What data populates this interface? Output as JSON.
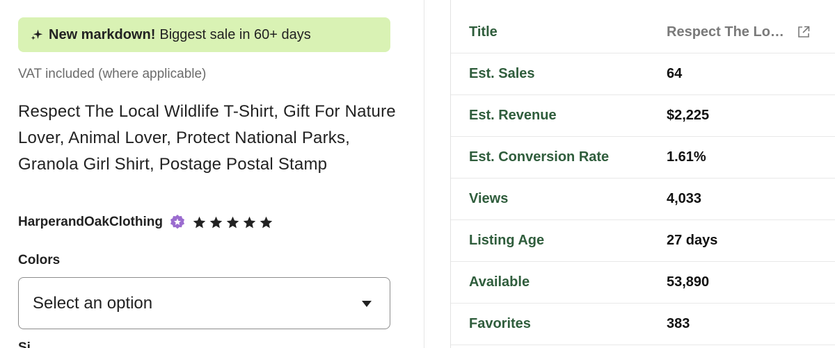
{
  "listing": {
    "banner_bold": "New markdown!",
    "banner_text": "Biggest sale in 60+ days",
    "vat_text": "VAT included (where applicable)",
    "title": "Respect The Local Wildlife T-Shirt, Gift For Nature Lover, Animal Lover, Protect National Parks, Granola Girl Shirt, Postage Postal Stamp",
    "shop_name": "HarperandOakClothing",
    "rating_stars": 5,
    "colors_label": "Colors",
    "colors_select_value": "Select an option",
    "next_label_cut": "Si"
  },
  "stats": {
    "rows": [
      {
        "label": "Title",
        "value": "Respect The Lo…",
        "muted": true
      },
      {
        "label": "Est. Sales",
        "value": "64"
      },
      {
        "label": "Est. Revenue",
        "value": "$2,225"
      },
      {
        "label": "Est. Conversion Rate",
        "value": "1.61%"
      },
      {
        "label": "Views",
        "value": "4,033"
      },
      {
        "label": "Listing Age",
        "value": "27 days"
      },
      {
        "label": "Available",
        "value": "53,890"
      },
      {
        "label": "Favorites",
        "value": "383"
      }
    ]
  },
  "colors": {
    "banner_bg": "#d9f2b4",
    "label_green": "#2f5d3c",
    "star_seller_purple": "#9b6ccf"
  },
  "icons": {
    "banner": "sparkle-icon",
    "badge": "star-seller-badge-icon",
    "rating": "star-icon",
    "select": "caret-down-icon",
    "external": "external-link-icon"
  }
}
